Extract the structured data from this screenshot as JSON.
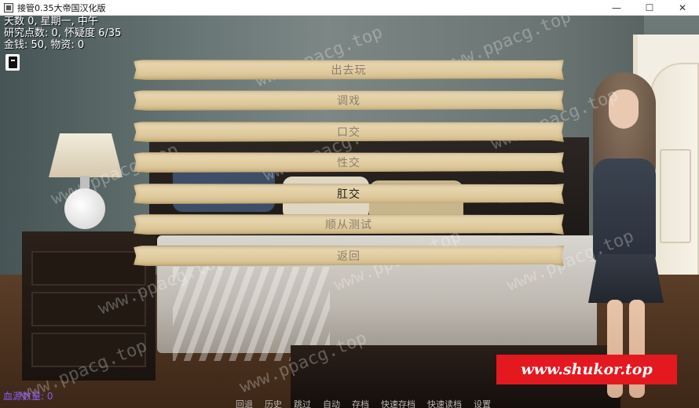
{
  "window": {
    "title": "接管0.35大帝国汉化版",
    "controls": {
      "minimize": "—",
      "maximize": "☐",
      "close": "✕"
    }
  },
  "hud": {
    "line1": "天数 0, 星期一, 中午",
    "line2": "研究点数: 0, 怀疑度 6/35",
    "line3": "金钱: 50, 物资: 0"
  },
  "menu": {
    "items": [
      {
        "label": "出去玩"
      },
      {
        "label": "调戏"
      },
      {
        "label": "口交"
      },
      {
        "label": "性交"
      },
      {
        "label": "肛交"
      },
      {
        "label": "顺从测试"
      },
      {
        "label": "返回"
      }
    ],
    "hovered": "肛交"
  },
  "quick_menu": {
    "items": [
      "回退",
      "历史",
      "跳过",
      "自动",
      "存档",
      "快速存档",
      "快速读档",
      "设置"
    ]
  },
  "status": {
    "blood_label": "血源数量: 0"
  },
  "watermark": {
    "text": "www.ppacg.top"
  },
  "promo": {
    "text": "www.shukor.top"
  },
  "colors": {
    "menu_text": "#8a7e6e",
    "menu_text_active": "#1a1a1a",
    "promo_bg": "#e3191f",
    "blood_label": "#8b5cf6"
  },
  "icons": {
    "journal": "journal-icon",
    "app": "app-icon"
  }
}
